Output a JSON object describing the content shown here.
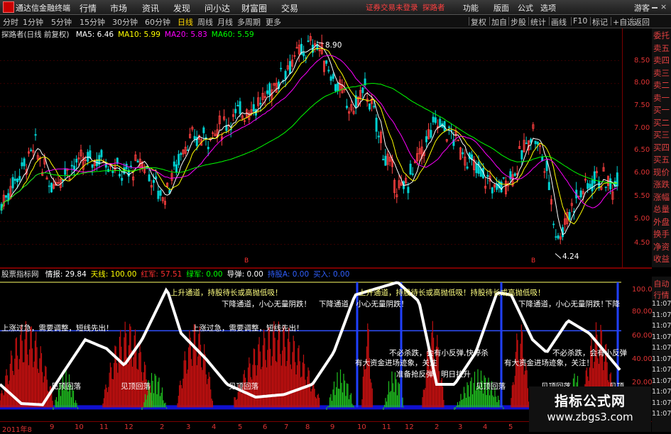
{
  "app": {
    "name": "通达信金融终端",
    "warning": "证券交易未登录",
    "user": "探路者",
    "guest": "游客"
  },
  "menu": [
    "行情",
    "市场",
    "资讯",
    "发现",
    "问小达",
    "财富圈",
    "交易"
  ],
  "right_menu": [
    "功能",
    "版面",
    "公式",
    "选项"
  ],
  "periods": [
    "分时",
    "1分钟",
    "5分钟",
    "15分钟",
    "30分钟",
    "60分钟",
    "日线",
    "周线",
    "月线",
    "多周期",
    "更多"
  ],
  "active_period": "日线",
  "toolbar_right": [
    "复权",
    "加自",
    "步股",
    "统计",
    "画线",
    "F10",
    "标记",
    "+自选",
    "返回"
  ],
  "stock": {
    "title": "探路者(日线 前复权)"
  },
  "ma": [
    {
      "label": "MA5: 6.46",
      "color": "#ffffff"
    },
    {
      "label": "MA10: 5.99",
      "color": "#ffff00"
    },
    {
      "label": "MA20: 5.83",
      "color": "#ff00ff"
    },
    {
      "label": "MA60: 5.59",
      "color": "#00ff00"
    }
  ],
  "price_axis": [
    "8.50",
    "8.00",
    "7.50",
    "7.00",
    "6.50",
    "6.00",
    "5.50",
    "5.00",
    "4.50"
  ],
  "price_annotations": {
    "high": "8.90",
    "low": "4.24"
  },
  "right_panel": [
    "委托",
    "卖五",
    "卖四",
    "卖三",
    "卖二",
    "卖一",
    "买一",
    "买二",
    "买三",
    "买四",
    "买五",
    "现价",
    "涨跌",
    "涨幅",
    "总量",
    "外盘",
    "换手",
    "净资",
    "收益"
  ],
  "indicator": {
    "name": "股票指标网",
    "items": [
      {
        "label": "情报: 29.84",
        "color": "#ffffff"
      },
      {
        "label": "天线: 100.00",
        "color": "#ffff00"
      },
      {
        "label": "红军: 57.51",
        "color": "#ff3030"
      },
      {
        "label": "绿军: 0.00",
        "color": "#00ff00"
      },
      {
        "label": "导弹: 0.00",
        "color": "#ffffff"
      },
      {
        "label": "持股A: 0.00",
        "color": "#3060ff"
      },
      {
        "label": "买入: 0.00",
        "color": "#3060ff"
      }
    ]
  },
  "ind_axis": [
    "100.0",
    "80.00",
    "60.00",
    "40.00",
    "20.00"
  ],
  "ind_texts": [
    "上升通道，持股待长或高抛低吸！",
    "上升通道，持股待长或高抛低吸！持股待长或高抛低吸！",
    "下降通道，小心无量阴跌！",
    "下降通道，小心无量阴跌！",
    "下降通道，小心无量阴跌！",
    "下降",
    "上涨过急，需要调整，短线先出！",
    "上涨过急，需要调整，短线先出！",
    "见顶回落",
    "见顶回落",
    "见顶回落",
    "见顶回落",
    "见顶回落",
    "见顶",
    "不必杀跌，会有小反弹,快停杀",
    "有大资金进场迹象，关注",
    "准备抢反弹，明日拉升",
    "不必杀跌，会有小反弹",
    "有大资金进场迹象，关注！"
  ],
  "ind_right_panel": [
    "自动",
    "行情",
    "11:07",
    "11:07",
    "11:07",
    "11:07",
    "11:07",
    "11:07",
    "11:07",
    "11:07",
    "11:07",
    "11:07",
    "11:07"
  ],
  "x_axis": [
    "2011年8",
    "9",
    "10",
    "11",
    "12",
    "2",
    "3",
    "4",
    "5",
    "6",
    "7",
    "8",
    "9",
    "10",
    "11",
    "12",
    "2",
    "3",
    "4",
    "5"
  ],
  "watermark": {
    "title": "指标公式网",
    "url": "www.zbgs3.com"
  },
  "chart_data": {
    "type": "candlestick",
    "ylim": [
      4.24,
      8.9
    ],
    "y_ticks": [
      8.5,
      8.0,
      7.5,
      7.0,
      6.5,
      6.0,
      5.5,
      5.0,
      4.5
    ],
    "high": 8.9,
    "low": 4.24,
    "indicator_ylim": [
      0,
      100
    ],
    "indicator_ticks": [
      100,
      80,
      60,
      40,
      20
    ]
  }
}
